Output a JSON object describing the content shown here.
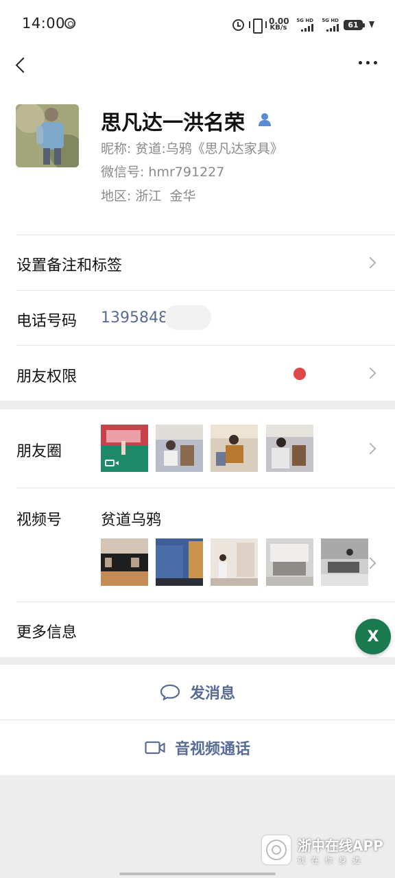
{
  "status_bar": {
    "time": "14:00",
    "net_speed_value": "0.00",
    "net_speed_unit": "KB/s",
    "sim1": "5G HD",
    "sim2": "5G HD",
    "battery": "61"
  },
  "profile": {
    "name": "思凡达一洪名荣",
    "nickname_label": "昵称:",
    "nickname": "贫道:乌鸦《思凡达家具》",
    "wechat_id_label": "微信号:",
    "wechat_id": "hmr791227",
    "region_label": "地区:",
    "region": "浙江  金华"
  },
  "rows": {
    "remark_tags": "设置备注和标签",
    "phone_label": "电话号码",
    "phone_value": "1395848",
    "friend_permission": "朋友权限",
    "moments": "朋友圈",
    "channels": "视频号",
    "channels_name": "贫道乌鸦",
    "more_info": "更多信息"
  },
  "actions": {
    "send_message": "发消息",
    "video_call": "音视频通话"
  },
  "fab_label": "X",
  "watermark": {
    "app_name": "浙中在线APP",
    "slogan": "就在你身边"
  },
  "colors": {
    "link_blue": "#576b95",
    "red_dot": "#e04747",
    "fab_green": "#1a7a4f"
  }
}
